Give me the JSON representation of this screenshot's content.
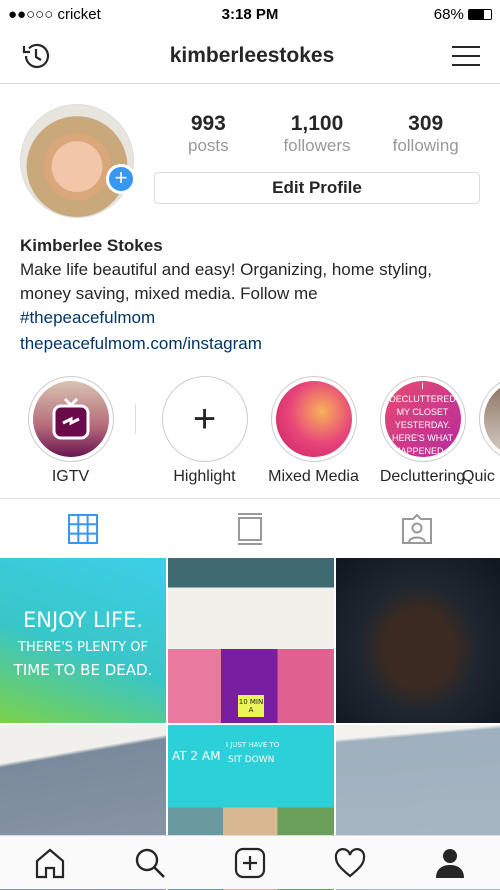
{
  "status": {
    "carrier": "●●○○○ cricket",
    "time": "3:18 PM",
    "battery": "68%"
  },
  "nav": {
    "username": "kimberleestokes",
    "left_icon": "history-icon",
    "right_icon": "menu-icon"
  },
  "stats": [
    {
      "n": "993",
      "l": "posts"
    },
    {
      "n": "1,100",
      "l": "followers"
    },
    {
      "n": "309",
      "l": "following"
    }
  ],
  "edit_profile": "Edit Profile",
  "bio": {
    "name": "Kimberlee Stokes",
    "text": "Make life beautiful and easy! Organizing, home styling, money saving, mixed media. Follow me",
    "hashtag": "#thepeacefulmom",
    "link": "thepeacefulmom.com/instagram"
  },
  "highlights": [
    {
      "label": "IGTV"
    },
    {
      "label": "Highlight"
    },
    {
      "label": "Mixed Media"
    },
    {
      "label": "Decluttering",
      "cover_text": "I DECLUTTERED MY CLOSET YESTERDAY. HERE'S WHAT HAPPENED..."
    },
    {
      "label": "Quic"
    }
  ],
  "tabs": [
    "grid-icon",
    "feed-icon",
    "tagged-icon"
  ],
  "accent": "#3897f0",
  "posts": [
    {
      "l1": "ENJOY LIFE.",
      "l2": "THERE'S PLENTY OF",
      "l3": "TIME TO BE DEAD."
    },
    {
      "note": "10 MIN A"
    },
    {},
    {},
    {
      "l1": "AT 2 AM",
      "l2": "I JUST HAVE TO",
      "l3": "SIT DOWN"
    },
    {}
  ]
}
